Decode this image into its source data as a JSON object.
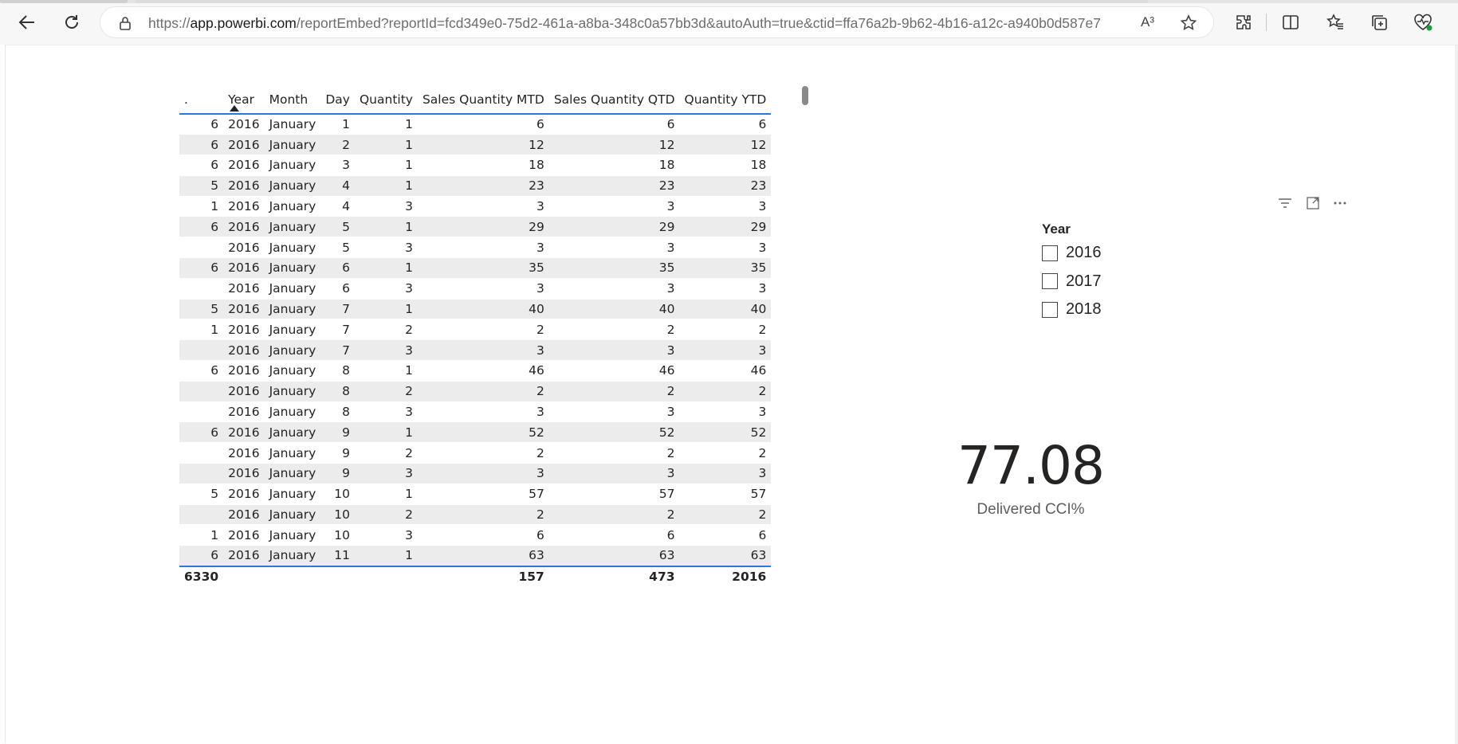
{
  "browser": {
    "url_prefix": "https://",
    "url_host": "app.powerbi.com",
    "url_rest": "/reportEmbed?reportId=fcd349e0-75d2-461a-a8ba-348c0a57bb3d&autoAuth=true&ctid=ffa76a2b-9b62-4b16-a12c-a940b0d587e7",
    "read_aloud_label": "A³"
  },
  "table": {
    "headers": [
      ".",
      "Year",
      "Month",
      "Day",
      "Quantity",
      "Sales Quantity MTD",
      "Sales Quantity QTD",
      "Quantity YTD"
    ],
    "rows": [
      [
        "6",
        "2016",
        "January",
        "1",
        "1",
        "6",
        "6",
        "6"
      ],
      [
        "6",
        "2016",
        "January",
        "2",
        "1",
        "12",
        "12",
        "12"
      ],
      [
        "6",
        "2016",
        "January",
        "3",
        "1",
        "18",
        "18",
        "18"
      ],
      [
        "5",
        "2016",
        "January",
        "4",
        "1",
        "23",
        "23",
        "23"
      ],
      [
        "1",
        "2016",
        "January",
        "4",
        "3",
        "3",
        "3",
        "3"
      ],
      [
        "6",
        "2016",
        "January",
        "5",
        "1",
        "29",
        "29",
        "29"
      ],
      [
        "",
        "2016",
        "January",
        "5",
        "3",
        "3",
        "3",
        "3"
      ],
      [
        "6",
        "2016",
        "January",
        "6",
        "1",
        "35",
        "35",
        "35"
      ],
      [
        "",
        "2016",
        "January",
        "6",
        "3",
        "3",
        "3",
        "3"
      ],
      [
        "5",
        "2016",
        "January",
        "7",
        "1",
        "40",
        "40",
        "40"
      ],
      [
        "1",
        "2016",
        "January",
        "7",
        "2",
        "2",
        "2",
        "2"
      ],
      [
        "",
        "2016",
        "January",
        "7",
        "3",
        "3",
        "3",
        "3"
      ],
      [
        "6",
        "2016",
        "January",
        "8",
        "1",
        "46",
        "46",
        "46"
      ],
      [
        "",
        "2016",
        "January",
        "8",
        "2",
        "2",
        "2",
        "2"
      ],
      [
        "",
        "2016",
        "January",
        "8",
        "3",
        "3",
        "3",
        "3"
      ],
      [
        "6",
        "2016",
        "January",
        "9",
        "1",
        "52",
        "52",
        "52"
      ],
      [
        "",
        "2016",
        "January",
        "9",
        "2",
        "2",
        "2",
        "2"
      ],
      [
        "",
        "2016",
        "January",
        "9",
        "3",
        "3",
        "3",
        "3"
      ],
      [
        "5",
        "2016",
        "January",
        "10",
        "1",
        "57",
        "57",
        "57"
      ],
      [
        "",
        "2016",
        "January",
        "10",
        "2",
        "2",
        "2",
        "2"
      ],
      [
        "1",
        "2016",
        "January",
        "10",
        "3",
        "6",
        "6",
        "6"
      ],
      [
        "6",
        "2016",
        "January",
        "11",
        "1",
        "63",
        "63",
        "63"
      ]
    ],
    "totals": [
      "6330",
      "",
      "",
      "",
      "",
      "157",
      "473",
      "2016"
    ]
  },
  "slicer": {
    "title": "Year",
    "options": [
      "2016",
      "2017",
      "2018"
    ]
  },
  "card": {
    "value": "77.08",
    "label": "Delivered CCI%"
  }
}
